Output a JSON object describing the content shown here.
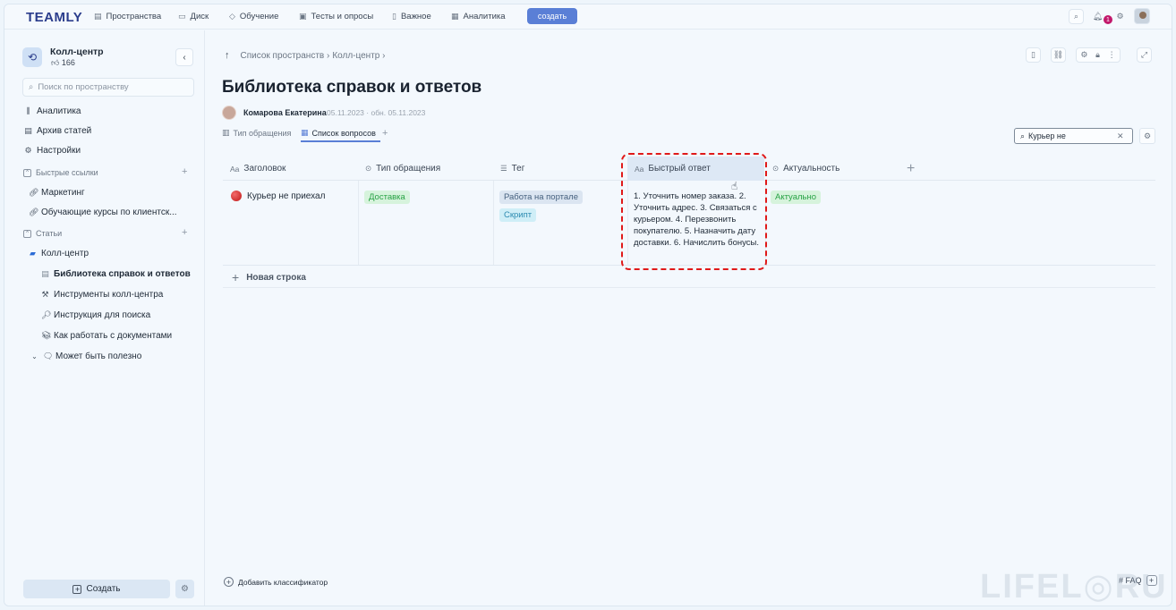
{
  "topnav": {
    "logo": "TEAMLY",
    "items": [
      {
        "label": "Пространства",
        "icon": "spaces-icon"
      },
      {
        "label": "Диск",
        "icon": "folder-icon"
      },
      {
        "label": "Обучение",
        "icon": "graduation-icon"
      },
      {
        "label": "Тесты и опросы",
        "icon": "tests-icon"
      },
      {
        "label": "Важное",
        "icon": "bookmark-icon"
      },
      {
        "label": "Аналитика",
        "icon": "chart-icon"
      }
    ],
    "create_label": "создать",
    "notification_count": "1"
  },
  "sidebar": {
    "space_name": "Колл-центр",
    "space_likes": "166",
    "search_placeholder": "Поиск по пространству",
    "items": {
      "analytics": "Аналитика",
      "archive": "Архив статей",
      "settings": "Настройки"
    },
    "quick_links_label": "Быстрые ссылки",
    "quick_links": [
      "Маркетинг",
      "Обучающие курсы по клиентск..."
    ],
    "articles_label": "Статьи",
    "tree": {
      "root": "Колл-центр",
      "children": [
        "Библиотека справок и ответов",
        "Инструменты колл-центра",
        "Инструкция для поиска",
        "Как работать с документами",
        "Может быть полезно"
      ]
    },
    "create_label": "Создать"
  },
  "page": {
    "breadcrumb": [
      "Список пространств",
      "Колл-центр"
    ],
    "title": "Библиотека справок и ответов",
    "author": "Комарова Екатерина",
    "dates": "05.11.2023 · обн. 05.11.2023",
    "tabs": [
      "Тип обращения",
      "Список вопросов"
    ],
    "search_value": "Курьер не"
  },
  "table": {
    "columns": [
      "Заголовок",
      "Тип обращения",
      "Тег",
      "Быстрый ответ",
      "Актуальность"
    ],
    "rows": [
      {
        "title": "Курьер не приехал",
        "type": "Доставка",
        "tags": [
          "Работа на портале",
          "Скрипт"
        ],
        "answer": "1. Уточнить номер заказа. 2. Уточнить адрес. 3. Связаться с курьером. 4. Перезвонить покупателю. 5. Назначить дату доставки. 6. Начислить бонусы.",
        "status": "Актуально"
      }
    ],
    "new_row_label": "Новая строка"
  },
  "footer": {
    "add_classifier": "Добавить классификатор",
    "faq_label": "# FAQ"
  },
  "watermark": "LIFEL◎RU",
  "colors": {
    "accent": "#5a7fd6",
    "highlight_border": "#e01919",
    "status_green": "#27a244"
  }
}
